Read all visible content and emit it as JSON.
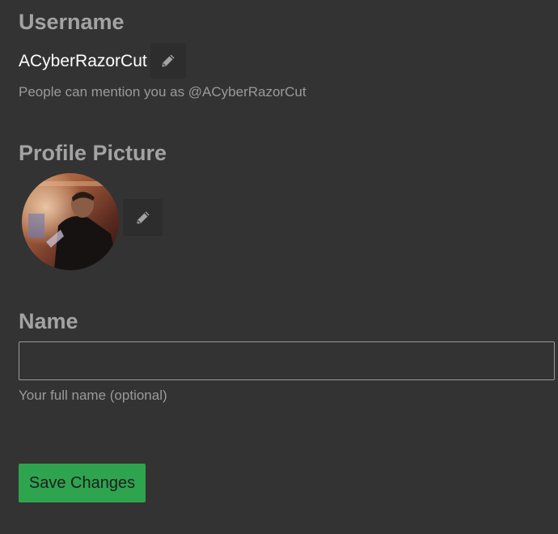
{
  "username": {
    "heading": "Username",
    "value": "ACyberRazorCut",
    "edit_icon": "pencil-icon",
    "mention_hint": "People can mention you as @ACyberRazorCut"
  },
  "profile_picture": {
    "heading": "Profile Picture",
    "edit_icon": "pencil-icon"
  },
  "name": {
    "heading": "Name",
    "value": "",
    "placeholder": "",
    "hint": "Your full name (optional)"
  },
  "actions": {
    "save_label": "Save Changes"
  },
  "colors": {
    "background": "#333333",
    "heading": "#a3a3a3",
    "helper_text": "#9a9a9a",
    "primary_button": "#2ea44f"
  }
}
